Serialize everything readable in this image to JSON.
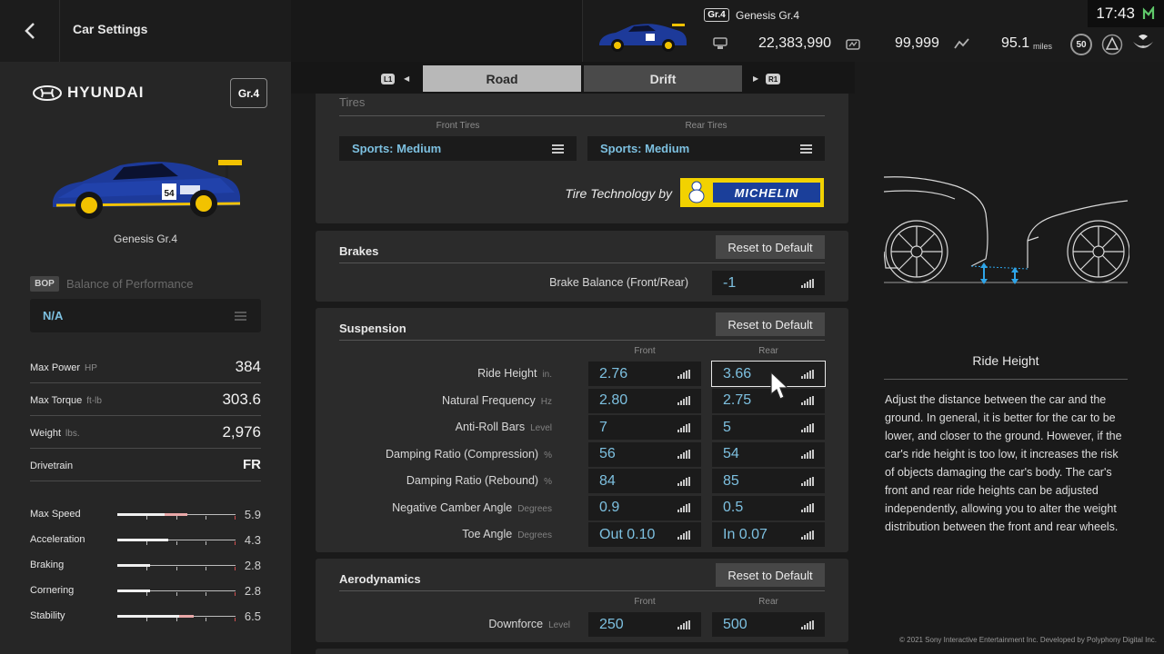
{
  "header": {
    "title": "Car Settings",
    "class_badge": "Gr.4",
    "car_name": "Genesis Gr.4",
    "credits": "22,383,990",
    "mileage_points": "99,999",
    "distance": "95.1",
    "distance_unit": "miles",
    "level": "50",
    "clock": "17:43"
  },
  "car": {
    "brand": "HYUNDAI",
    "class_badge": "Gr.4",
    "name": "Genesis Gr.4",
    "livery_number": "54"
  },
  "bop": {
    "tag": "BOP",
    "label": "Balance of Performance",
    "value": "N/A"
  },
  "specs": [
    {
      "label": "Max Power",
      "unit": "HP",
      "value": "384"
    },
    {
      "label": "Max Torque",
      "unit": "ft-lb",
      "value": "303.6"
    },
    {
      "label": "Weight",
      "unit": "lbs.",
      "value": "2,976"
    },
    {
      "label": "Drivetrain",
      "unit": "",
      "value": "FR"
    }
  ],
  "performance": [
    {
      "label": "Max Speed",
      "value": "5.9",
      "base": 0.4,
      "boost": 0.59
    },
    {
      "label": "Acceleration",
      "value": "4.3",
      "base": 0.43,
      "boost": 0.43
    },
    {
      "label": "Braking",
      "value": "2.8",
      "base": 0.28,
      "boost": 0.28
    },
    {
      "label": "Cornering",
      "value": "2.8",
      "base": 0.28,
      "boost": 0.28
    },
    {
      "label": "Stability",
      "value": "6.5",
      "base": 0.52,
      "boost": 0.65
    }
  ],
  "tabs": {
    "left_button": "L1",
    "right_button": "R1",
    "road": "Road",
    "drift": "Drift"
  },
  "tires": {
    "title": "Tires",
    "front_label": "Front Tires",
    "rear_label": "Rear Tires",
    "front_value": "Sports: Medium",
    "rear_value": "Sports: Medium",
    "tech_by": "Tire Technology by",
    "sponsor": "MICHELIN"
  },
  "brakes": {
    "title": "Brakes",
    "reset": "Reset to Default",
    "balance_label": "Brake Balance (Front/Rear)",
    "balance_value": "-1"
  },
  "suspension": {
    "title": "Suspension",
    "reset": "Reset to Default",
    "front_label": "Front",
    "rear_label": "Rear",
    "rows": [
      {
        "label": "Ride Height",
        "unit": "in.",
        "front": "2.76",
        "rear": "3.66"
      },
      {
        "label": "Natural Frequency",
        "unit": "Hz",
        "front": "2.80",
        "rear": "2.75"
      },
      {
        "label": "Anti-Roll Bars",
        "unit": "Level",
        "front": "7",
        "rear": "5"
      },
      {
        "label": "Damping Ratio (Compression)",
        "unit": "%",
        "front": "56",
        "rear": "54"
      },
      {
        "label": "Damping Ratio (Rebound)",
        "unit": "%",
        "front": "84",
        "rear": "85"
      },
      {
        "label": "Negative Camber Angle",
        "unit": "Degrees",
        "front": "0.9",
        "rear": "0.5"
      },
      {
        "label": "Toe Angle",
        "unit": "Degrees",
        "front": "Out 0.10",
        "rear": "In 0.07"
      }
    ]
  },
  "aero": {
    "title": "Aerodynamics",
    "reset": "Reset to Default",
    "front_label": "Front",
    "rear_label": "Rear",
    "downforce_label": "Downforce",
    "downforce_unit": "Level",
    "front": "250",
    "rear": "500"
  },
  "help": {
    "title": "Ride Height",
    "description": "Adjust the distance between the car and the ground. In general, it is better for the car to be lower, and closer to the ground. However, if the car's ride height is too low, it increases the risk of objects damaging the car's body. The car's front and rear ride heights can be adjusted independently, allowing you to alter the weight distribution between the front and rear wheels."
  },
  "footer": {
    "copyright": "© 2021 Sony Interactive Entertainment Inc. Developed by Polyphony Digital Inc."
  },
  "colors": {
    "accent_value": "#7dc0e0",
    "livery_blue": "#1d3a9a",
    "livery_yellow": "#f2c200",
    "clock_icon": "#5fc86a"
  }
}
